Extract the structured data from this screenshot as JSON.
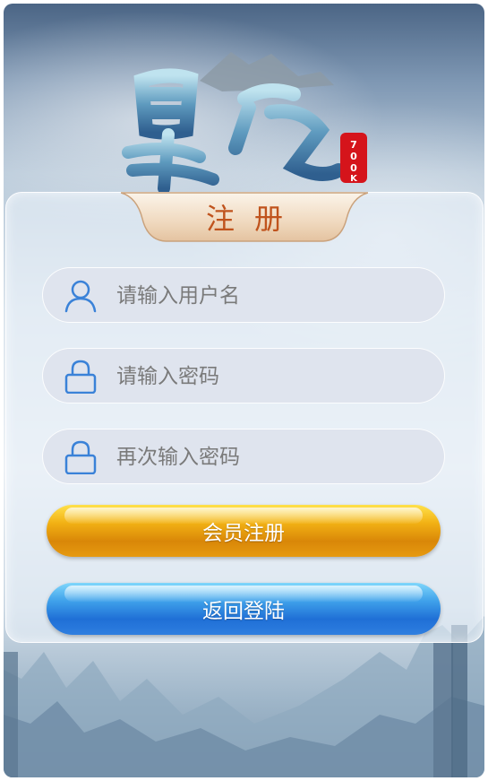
{
  "logo": {
    "title_chars": "昆仑",
    "seal_text": "700K"
  },
  "form": {
    "title": "注册",
    "username": {
      "placeholder": "请输入用户名",
      "value": ""
    },
    "password": {
      "placeholder": "请输入密码",
      "value": ""
    },
    "confirm_password": {
      "placeholder": "再次输入密码",
      "value": ""
    },
    "register_button": "会员注册",
    "back_button": "返回登陆"
  },
  "colors": {
    "title": "#c0531d",
    "register_button": "#e69a10",
    "back_button": "#2f7fe0",
    "icon": "#3a82d8"
  },
  "icons": [
    "user-icon",
    "lock-icon",
    "lock-icon"
  ]
}
